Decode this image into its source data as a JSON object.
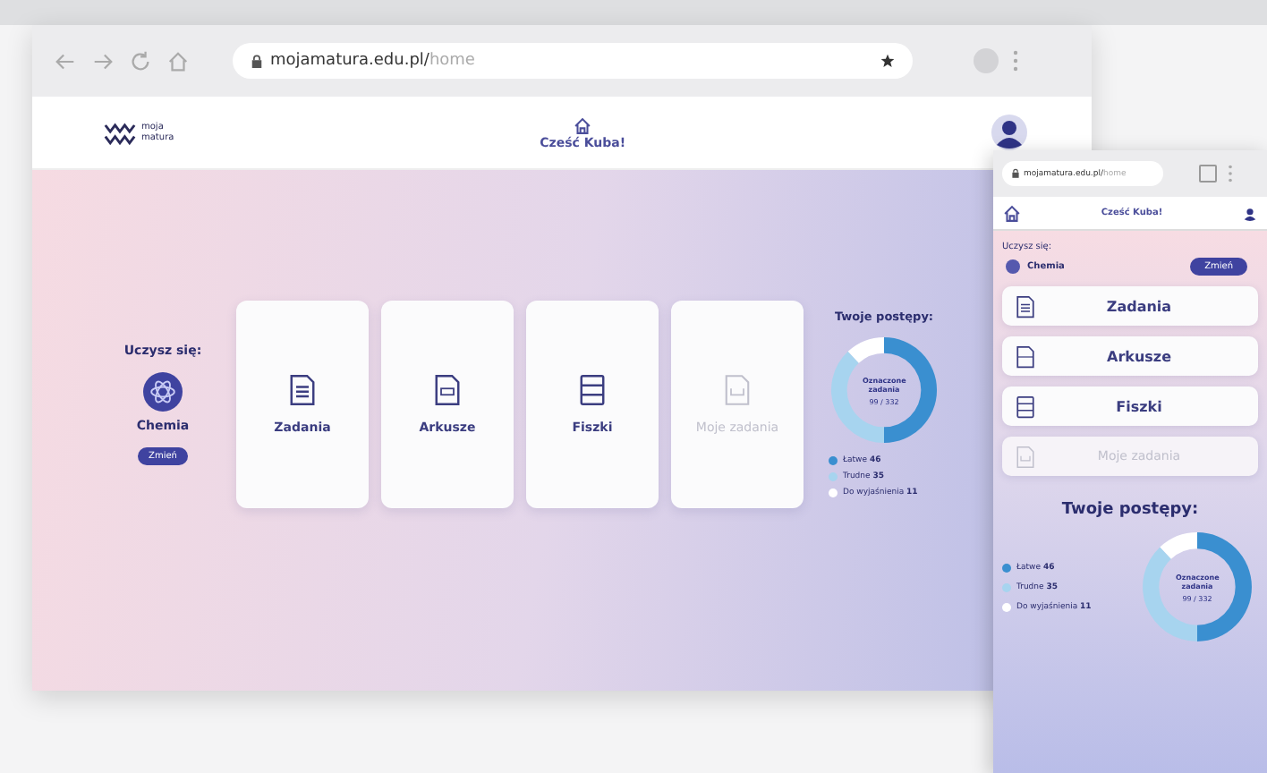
{
  "desktop": {
    "url_host": "mojamatura.edu.pl/",
    "url_path": "home",
    "logo": [
      "moja",
      "matura"
    ],
    "greeting": "Cześć Kuba!",
    "subject": {
      "label": "Uczysz się:",
      "name": "Chemia",
      "button": "Zmień"
    },
    "sections": [
      {
        "kind": "tasks",
        "label": "Zadania",
        "disabled": false
      },
      {
        "kind": "sheets",
        "label": "Arkusze",
        "disabled": false
      },
      {
        "kind": "flashcards",
        "label": "Fiszki",
        "disabled": false
      },
      {
        "kind": "custom",
        "label": "Moje zadania",
        "disabled": true
      }
    ],
    "progress": {
      "title": "Twoje postępy:",
      "center_title": "Oznaczone zadania",
      "center_value": "99 / 332",
      "legend": [
        {
          "label": "Łatwe",
          "count": "46",
          "color": "#3a8fd0"
        },
        {
          "label": "Trudne",
          "count": "35",
          "color": "#a7d4ef"
        },
        {
          "label": "Do wyjaśnienia",
          "count": "11",
          "color": "#ffffff"
        }
      ]
    }
  },
  "mobile": {
    "url_host": "mojamatura.edu.pl/",
    "url_path": "home",
    "greeting": "Cześć Kuba!",
    "subject": {
      "label": "Uczysz się:",
      "name": "Chemia",
      "button": "Zmień"
    },
    "sections": [
      {
        "kind": "tasks",
        "label": "Zadania",
        "disabled": false
      },
      {
        "kind": "sheets",
        "label": "Arkusze",
        "disabled": false
      },
      {
        "kind": "flashcards",
        "label": "Fiszki",
        "disabled": false
      },
      {
        "kind": "custom",
        "label": "Moje zadania",
        "disabled": true
      }
    ],
    "progress": {
      "title": "Twoje postępy:",
      "center_title": "Oznaczone zadania",
      "center_value": "99 / 332",
      "legend": [
        {
          "label": "Łatwe",
          "count": "46",
          "color": "#3a8fd0"
        },
        {
          "label": "Trudne",
          "count": "35",
          "color": "#a7d4ef"
        },
        {
          "label": "Do wyjaśnienia",
          "count": "11",
          "color": "#ffffff"
        }
      ]
    }
  }
}
